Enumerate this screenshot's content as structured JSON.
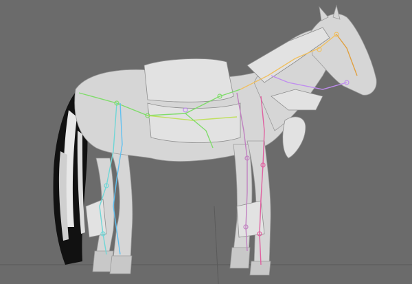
{
  "viewport": {
    "name": "3d-viewport",
    "model": "horse-rig",
    "background_color": "#6b6b6b",
    "model_color": "#d4d4d4",
    "bone_colors": [
      "#7fdc6a",
      "#c08cf0",
      "#6fd6d6",
      "#f0c060",
      "#c080c0",
      "#e060a0"
    ]
  }
}
